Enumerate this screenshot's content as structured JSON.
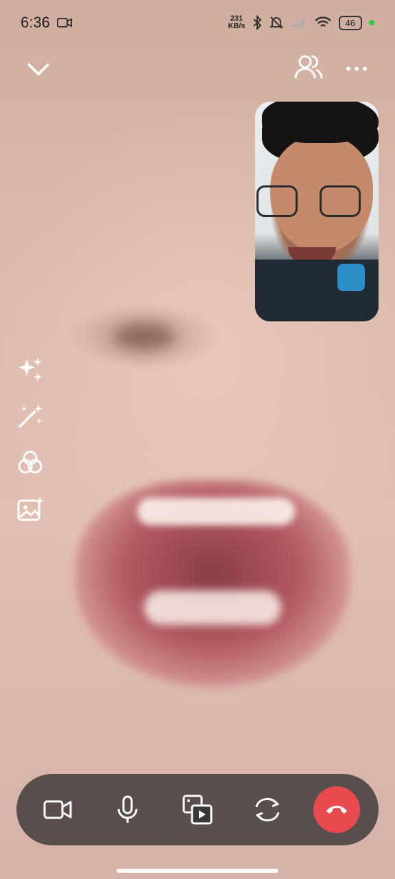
{
  "status_bar": {
    "time": "6:36",
    "net_speed_value": "231",
    "net_speed_unit": "KB/s",
    "battery": "46"
  },
  "top_bar": {
    "collapse_icon": "chevron-down-icon",
    "participants_icon": "people-icon",
    "more_icon": "more-dots-icon"
  },
  "effects": [
    {
      "icon": "sparkles-icon"
    },
    {
      "icon": "magic-wand-icon"
    },
    {
      "icon": "filters-icon"
    },
    {
      "icon": "background-image-icon"
    }
  ],
  "controls": [
    {
      "icon": "video-camera-icon"
    },
    {
      "icon": "microphone-icon"
    },
    {
      "icon": "share-media-icon"
    },
    {
      "icon": "flip-camera-icon"
    },
    {
      "icon": "end-call-icon"
    }
  ],
  "colors": {
    "end_call": "#e84a4f",
    "control_bar": "#3c3737",
    "signal_dot": "#2ecc40"
  }
}
